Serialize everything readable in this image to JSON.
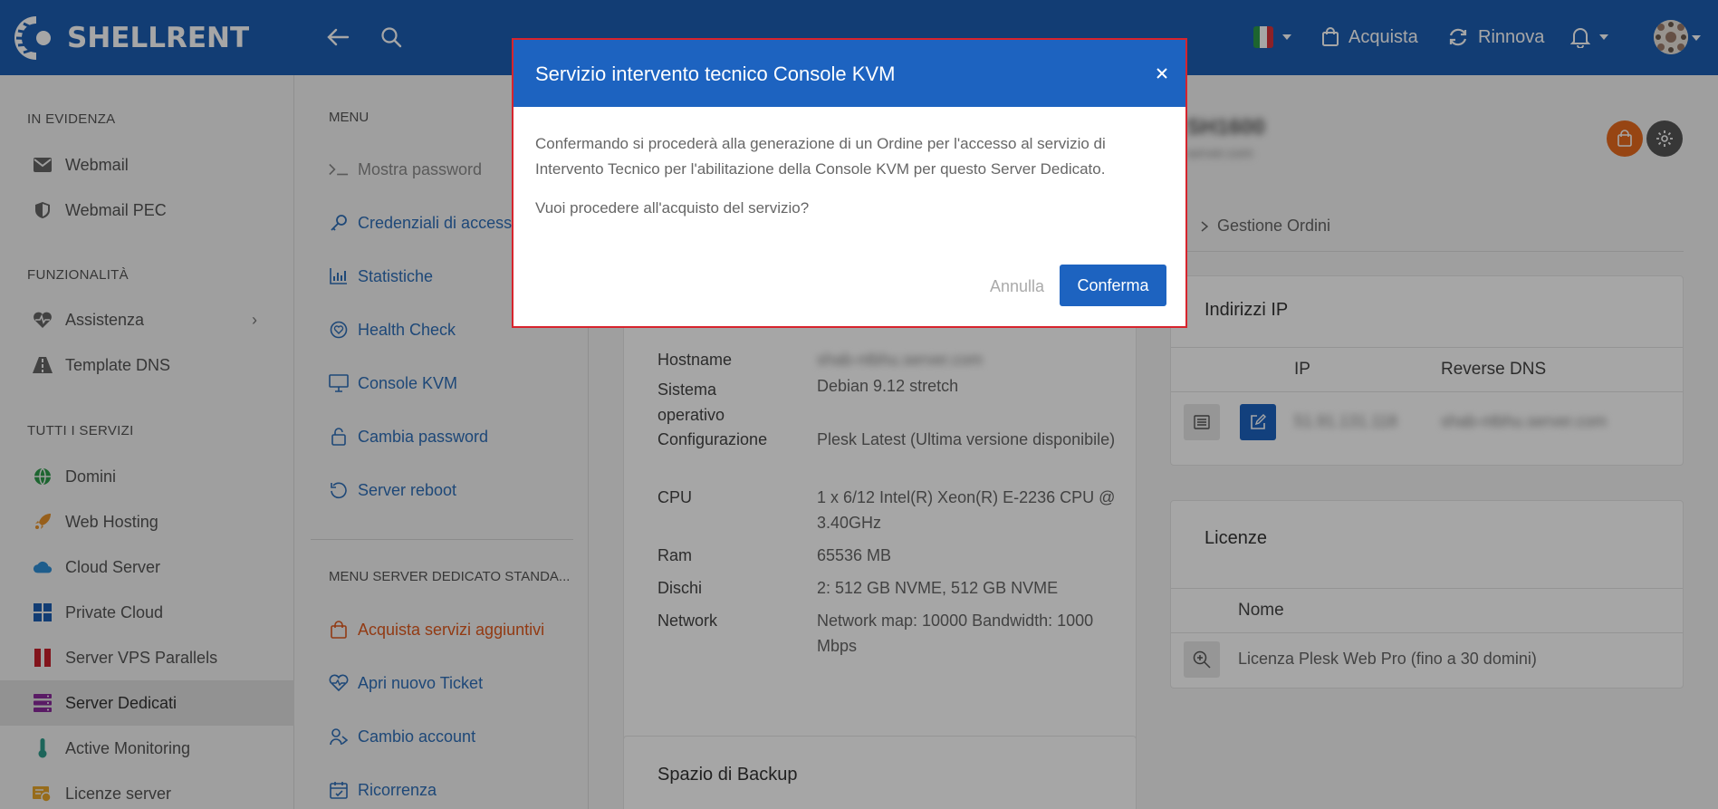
{
  "header": {
    "brand": "SHELLRENT",
    "buy_label": "Acquista",
    "renew_label": "Rinnova",
    "language": "it"
  },
  "sidebar": {
    "sections": [
      {
        "title": "IN EVIDENZA",
        "items": [
          "Webmail",
          "Webmail PEC"
        ]
      },
      {
        "title": "FUNZIONALITÀ",
        "items": [
          "Assistenza",
          "Template DNS"
        ]
      },
      {
        "title": "TUTTI I SERVIZI",
        "items": [
          "Domini",
          "Web Hosting",
          "Cloud Server",
          "Private Cloud",
          "Server VPS Parallels",
          "Server Dedicati",
          "Active Monitoring",
          "Licenze server"
        ]
      }
    ],
    "active_item": "Server Dedicati"
  },
  "menu": {
    "title": "MENU",
    "items": [
      "Mostra password",
      "Credenziali di accesso",
      "Statistiche",
      "Health Check",
      "Console KVM",
      "Cambia password",
      "Server reboot"
    ],
    "section2_title": "MENU SERVER DEDICATO STANDA...",
    "items2": [
      "Acquista servizi aggiuntivi",
      "Apri nuovo Ticket",
      "Cambio account",
      "Ricorrenza"
    ]
  },
  "details": {
    "hostname_label": "Hostname",
    "hostname_value": "shab-ntbhu.server.com",
    "os_label": "Sistema operativo",
    "os_value": "Debian 9.12 stretch",
    "config_label": "Configurazione",
    "config_value": "Plesk Latest (Ultima versione disponibile)",
    "cpu_label": "CPU",
    "cpu_value": "1 x 6/12 Intel(R) Xeon(R) E-2236 CPU @ 3.40GHz",
    "ram_label": "Ram",
    "ram_value": "65536 MB",
    "disks_label": "Dischi",
    "disks_value": "2: 512 GB NVME, 512 GB NVME",
    "network_label": "Network",
    "network_value": "Network map: 10000 Bandwidth: 1000 Mbps",
    "backup_title": "Spazio di Backup"
  },
  "right": {
    "server_name": "SH1600",
    "server_sub": "server.com",
    "orders_link": "Gestione Ordini",
    "ip_title": "Indirizzi IP",
    "ip_col": "IP",
    "rdns_col": "Reverse DNS",
    "ip_value": "51.91.131.118",
    "rdns_value": "shab-ntbhu.server.com",
    "licenses_title": "Licenze",
    "licenses_col": "Nome",
    "license_value": "Licenza Plesk Web Pro (fino a 30 domini)"
  },
  "modal": {
    "title": "Servizio intervento tecnico Console KVM",
    "body": "Confermando si procederà alla generazione di un Ordine per l'accesso al servizio di Intervento Tecnico per l'abilitazione della Console KVM per questo Server Dedicato.",
    "question": "Vuoi procedere all'acquisto del servizio?",
    "cancel_label": "Annulla",
    "confirm_label": "Conferma"
  },
  "colors": {
    "header": "#1d5fb3",
    "accent_blue": "#2f6fb8",
    "accent_orange": "#e05a1e",
    "modal_border": "#d7242d"
  }
}
